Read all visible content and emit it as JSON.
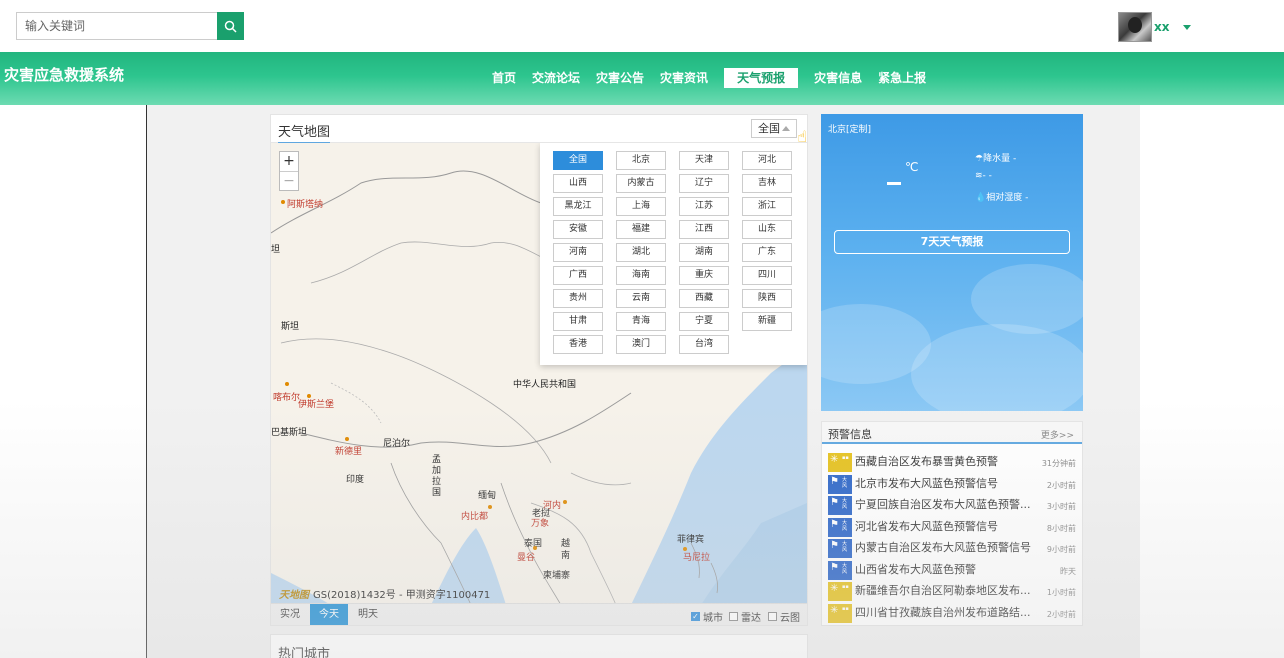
{
  "search": {
    "placeholder": "输入关键词"
  },
  "user": {
    "name": "xx"
  },
  "nav": {
    "logo": "灾害应急救援系统",
    "items": [
      "首页",
      "交流论坛",
      "灾害公告",
      "灾害资讯",
      "天气预报",
      "灾害信息",
      "紧急上报"
    ],
    "active": "天气预报"
  },
  "map": {
    "title": "天气地图",
    "province_selected": "全国",
    "zoom_in": "+",
    "zoom_out": "−",
    "provinces": [
      "全国",
      "北京",
      "天津",
      "河北",
      "山西",
      "内蒙古",
      "辽宁",
      "吉林",
      "黑龙江",
      "上海",
      "江苏",
      "浙江",
      "安徽",
      "福建",
      "江西",
      "山东",
      "河南",
      "湖北",
      "湖南",
      "广东",
      "广西",
      "海南",
      "重庆",
      "四川",
      "贵州",
      "云南",
      "西藏",
      "陕西",
      "甘肃",
      "青海",
      "宁夏",
      "新疆",
      "香港",
      "澳门",
      "台湾"
    ],
    "labels": {
      "afghan_label": "阿斯塔纳",
      "pak": "斯坦",
      "dan": "坦",
      "china": "中华人民共和国",
      "kabul": "喀布尔",
      "islamabad": "伊斯兰堡",
      "jibasitan": "巴基斯坦",
      "nepal": "尼泊尔",
      "newdelhi": "新德里",
      "india": "印度",
      "bangladesh": "孟加拉国",
      "myanmar": "缅甸",
      "naypyidaw": "内比都",
      "laos": "老挝",
      "vientiane": "万象",
      "thailand": "泰国",
      "bangkok": "曼谷",
      "vietnam": "越南",
      "cambodia": "柬埔寨",
      "philippines": "菲律宾",
      "manila": "马尼拉",
      "hanoi": "河内"
    },
    "copyright_brand": "天地图",
    "copyright": "GS(2018)1432号 - 甲测资字1100471",
    "tabs": [
      "实况",
      "今天",
      "明天"
    ],
    "active_tab": "今天",
    "layers": [
      {
        "label": "城市",
        "checked": true
      },
      {
        "label": "雷达",
        "checked": false
      },
      {
        "label": "云图",
        "checked": false
      }
    ]
  },
  "hot_city": {
    "title": "热门城市"
  },
  "weather": {
    "city": "北京[定制]",
    "unit": "℃",
    "temp_dash": "—",
    "precip": "降水量 -",
    "wind": "- -",
    "humidity": "相对湿度 -",
    "btn": "7天天气预报"
  },
  "warnings": {
    "title": "预警信息",
    "more": "更多>>",
    "items": [
      {
        "text": "西藏自治区发布暴雪黄色预警",
        "time": "31分钟前",
        "color": "yellow"
      },
      {
        "text": "北京市发布大风蓝色预警信号",
        "time": "2小时前",
        "color": "blue"
      },
      {
        "text": "宁夏回族自治区发布大风蓝色预警...",
        "time": "3小时前",
        "color": "blue"
      },
      {
        "text": "河北省发布大风蓝色预警信号",
        "time": "8小时前",
        "color": "blue"
      },
      {
        "text": "内蒙古自治区发布大风蓝色预警信号",
        "time": "9小时前",
        "color": "blue"
      },
      {
        "text": "山西省发布大风蓝色预警",
        "time": "昨天",
        "color": "blue"
      },
      {
        "text": "新疆维吾尔自治区阿勒泰地区发布...",
        "time": "1小时前",
        "color": "yellow"
      },
      {
        "text": "四川省甘孜藏族自治州发布道路结...",
        "time": "2小时前",
        "color": "yellow"
      }
    ]
  },
  "colors": {
    "brand": "#1aa06d",
    "accent": "#2d8ddb",
    "warn_yellow": "#e6c21e",
    "warn_blue": "#2c66c9"
  }
}
